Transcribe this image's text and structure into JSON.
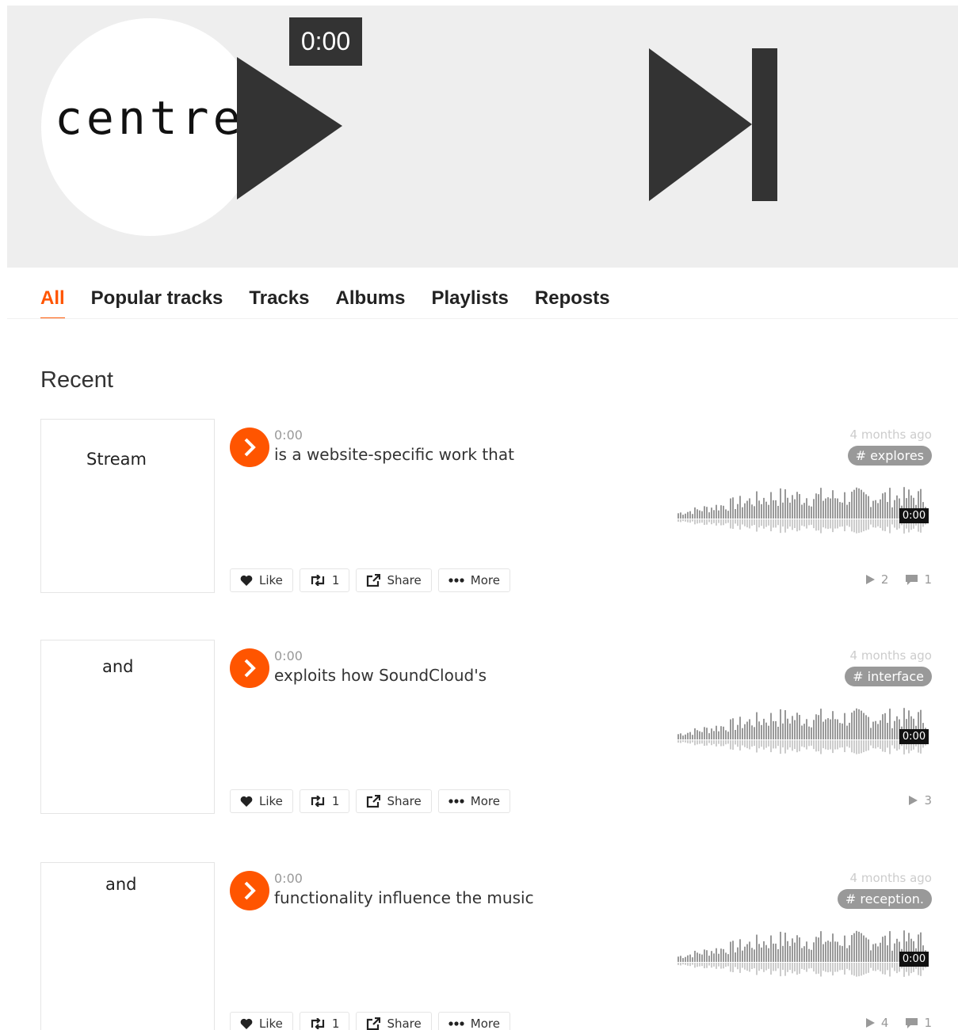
{
  "player": {
    "logo_text": "centre",
    "time": "0:00"
  },
  "tabs": [
    {
      "label": "All",
      "active": true
    },
    {
      "label": "Popular tracks"
    },
    {
      "label": "Tracks"
    },
    {
      "label": "Albums"
    },
    {
      "label": "Playlists"
    },
    {
      "label": "Reposts"
    }
  ],
  "section_title": "Recent",
  "accent_color": "#ff5500",
  "tracks": [
    {
      "artwork_text": "Stream",
      "time": "0:00",
      "title": "is a website-specific work that",
      "date": "4 months ago",
      "tag": "# explores",
      "wave_time": "0:00",
      "like_label": "Like",
      "repost_count": "1",
      "share_label": "Share",
      "more_label": "More",
      "plays": "2",
      "comments": "1"
    },
    {
      "artwork_text": "and",
      "time": "0:00",
      "title": "exploits how SoundCloud's",
      "date": "4 months ago",
      "tag": "# interface",
      "wave_time": "0:00",
      "like_label": "Like",
      "repost_count": "1",
      "share_label": "Share",
      "more_label": "More",
      "plays": "3"
    },
    {
      "artwork_text": "and",
      "time": "0:00",
      "title": "functionality influence the music",
      "date": "4 months ago",
      "tag": "# reception.",
      "wave_time": "0:00",
      "like_label": "Like",
      "repost_count": "1",
      "share_label": "Share",
      "more_label": "More",
      "plays": "4",
      "comments": "1"
    }
  ]
}
